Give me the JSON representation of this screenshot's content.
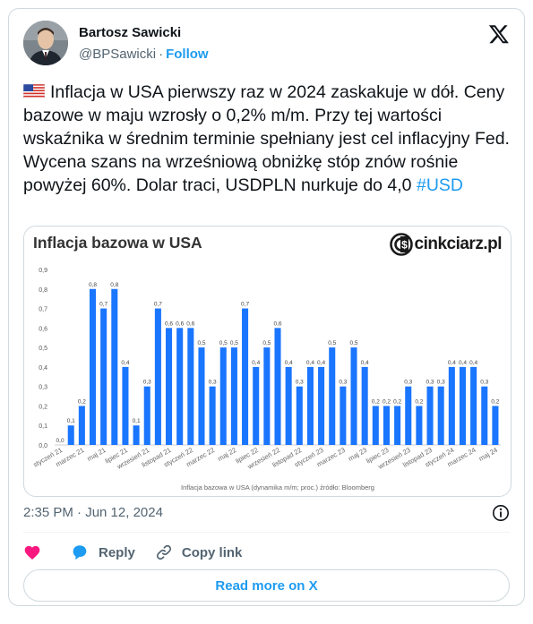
{
  "author": {
    "name": "Bartosz Sawicki",
    "handle": "@BPSawicki",
    "separator": "·",
    "follow_label": "Follow"
  },
  "tweet": {
    "text": "Inflacja w USA pierwszy raz w 2024 zaskakuje w dół. Ceny bazowe w maju wzrosły o 0,2% m/m. Przy tej wartości wskaźnika w średnim terminie spełniany jest cel inflacyjny Fed. Wycena szans na wrześniową obniżkę stóp znów rośnie powyżej 60%. Dolar traci, USDPLN nurkuje do 4,0",
    "hashtag": "#USD",
    "flag_icon": "us-flag-icon"
  },
  "media": {
    "brand": "cinkciarz.pl"
  },
  "chart_data": {
    "type": "bar",
    "title": "Inflacja bazowa w USA",
    "caption": "Inflacja bazowa w USA (dynamika m/m; proc.) źródło: Bloomberg",
    "ylim": [
      0,
      0.9
    ],
    "yticks": [
      "0,0",
      "0,1",
      "0,2",
      "0,3",
      "0,4",
      "0,5",
      "0,6",
      "0,7",
      "0,8",
      "0,9"
    ],
    "grid": false,
    "bar_color": "#1a75ff",
    "categories": [
      "styczeń 21",
      "luty 21",
      "marzec 21",
      "kwiecień 21",
      "maj 21",
      "czerwiec 21",
      "lipiec 21",
      "sierpień 21",
      "wrzesień 21",
      "październik 21",
      "listopad 21",
      "grudzień 21",
      "styczeń 22",
      "luty 22",
      "marzec 22",
      "kwiecień 22",
      "maj 22",
      "czerwiec 22",
      "lipiec 22",
      "sierpień 22",
      "wrzesień 22",
      "październik 22",
      "listopad 22",
      "grudzień 22",
      "styczeń 23",
      "luty 23",
      "marzec 23",
      "kwiecień 23",
      "maj 23",
      "czerwiec 23",
      "lipiec 23",
      "sierpień 23",
      "wrzesień 23",
      "październik 23",
      "listopad 23",
      "grudzień 23",
      "styczeń 24",
      "luty 24",
      "marzec 24",
      "kwiecień 24",
      "maj 24"
    ],
    "values": [
      0.0,
      0.1,
      0.2,
      0.8,
      0.7,
      0.8,
      0.4,
      0.1,
      0.3,
      0.7,
      0.6,
      0.6,
      0.6,
      0.5,
      0.3,
      0.5,
      0.5,
      0.7,
      0.4,
      0.5,
      0.6,
      0.4,
      0.3,
      0.4,
      0.4,
      0.5,
      0.3,
      0.5,
      0.4,
      0.2,
      0.2,
      0.2,
      0.3,
      0.2,
      0.3,
      0.3,
      0.4,
      0.4,
      0.4,
      0.3,
      0.2
    ],
    "value_labels": [
      "0,0",
      "0,1",
      "0,2",
      "0,8",
      "0,7",
      "0,8",
      "0,4",
      "0,1",
      "0,3",
      "0,7",
      "0,6",
      "0,6",
      "0,6",
      "0,5",
      "0,3",
      "0,5",
      "0,5",
      "0,7",
      "0,4",
      "0,5",
      "0,6",
      "0,4",
      "0,3",
      "0,4",
      "0,4",
      "0,5",
      "0,3",
      "0,5",
      "0,4",
      "0,2",
      "0,2",
      "0,2",
      "0,3",
      "0,2",
      "0,3",
      "0,3",
      "0,4",
      "0,4",
      "0,4",
      "0,3",
      "0,2"
    ],
    "shown_xtick_labels": [
      "styczeń 21",
      "marzec 21",
      "maj 21",
      "lipiec 21",
      "wrzesień 21",
      "listopad 21",
      "styczeń 22",
      "marzec 22",
      "maj 22",
      "lipiec 22",
      "wrzesień 22",
      "listopad 22",
      "styczeń 23",
      "marzec 23",
      "maj 23",
      "lipiec 23",
      "wrzesień 23",
      "listopad 23",
      "styczeń 24",
      "marzec 24",
      "maj 24"
    ]
  },
  "footer": {
    "timestamp": "2:35 PM · Jun 12, 2024",
    "like_icon": "heart-icon",
    "reply_label": "Reply",
    "copy_link_label": "Copy link",
    "read_more_label": "Read more on X"
  }
}
